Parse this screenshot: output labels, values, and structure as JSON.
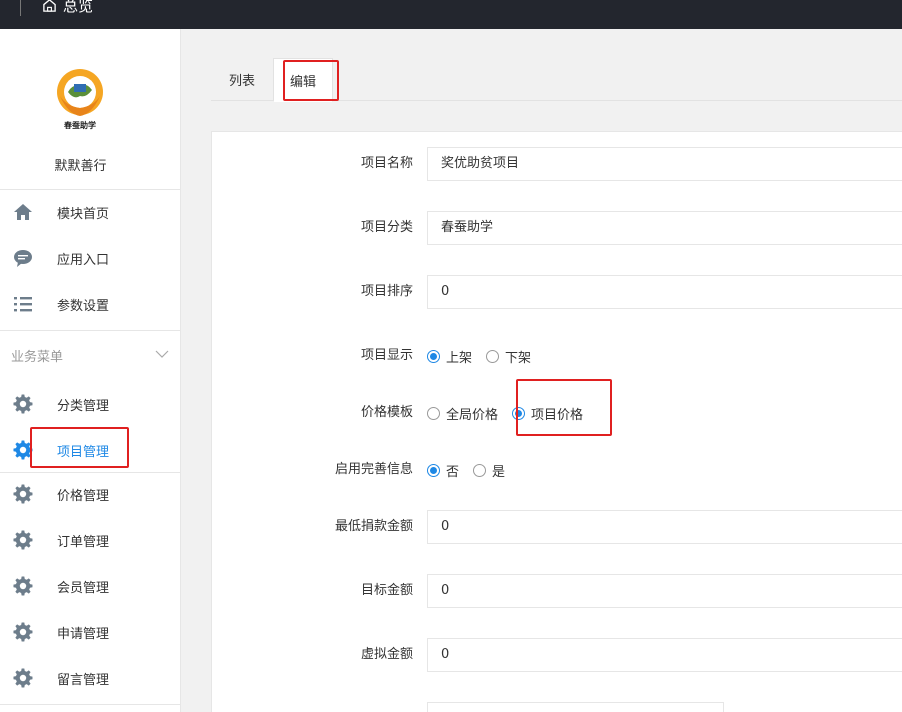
{
  "topbar": {
    "home_label": "总览"
  },
  "sidebar": {
    "brand_name": "默默善行",
    "logo_text": "春蚕助学",
    "top_items": [
      {
        "label": "模块首页",
        "icon": "home-icon"
      },
      {
        "label": "应用入口",
        "icon": "chat-icon"
      },
      {
        "label": "参数设置",
        "icon": "list-icon"
      }
    ],
    "group_label": "业务菜单",
    "group_items": [
      {
        "label": "分类管理",
        "icon": "gear-icon"
      },
      {
        "label": "项目管理",
        "icon": "gear-icon",
        "active": true
      },
      {
        "label": "价格管理",
        "icon": "gear-icon"
      },
      {
        "label": "订单管理",
        "icon": "gear-icon"
      },
      {
        "label": "会员管理",
        "icon": "gear-icon"
      },
      {
        "label": "申请管理",
        "icon": "gear-icon"
      },
      {
        "label": "留言管理",
        "icon": "gear-icon"
      }
    ]
  },
  "tabs": [
    {
      "label": "列表"
    },
    {
      "label": "编辑",
      "active": true
    }
  ],
  "form": {
    "name": {
      "label": "项目名称",
      "value": "奖优助贫项目"
    },
    "category": {
      "label": "项目分类",
      "value": "春蚕助学"
    },
    "sort": {
      "label": "项目排序",
      "value": "0"
    },
    "display": {
      "label": "项目显示",
      "options": [
        "上架",
        "下架"
      ],
      "selected": "上架"
    },
    "price_template": {
      "label": "价格模板",
      "options": [
        "全局价格",
        "项目价格"
      ],
      "selected": "项目价格"
    },
    "require_info": {
      "label": "启用完善信息",
      "options": [
        "否",
        "是"
      ],
      "selected": "否"
    },
    "min_donation": {
      "label": "最低捐款金额",
      "value": "0"
    },
    "target_amount": {
      "label": "目标金额",
      "value": "0"
    },
    "virtual_amount": {
      "label": "虚拟金额",
      "value": "0"
    }
  },
  "colors": {
    "accent": "#1e88e5",
    "highlight": "#e02020",
    "topbar": "#23262e"
  }
}
